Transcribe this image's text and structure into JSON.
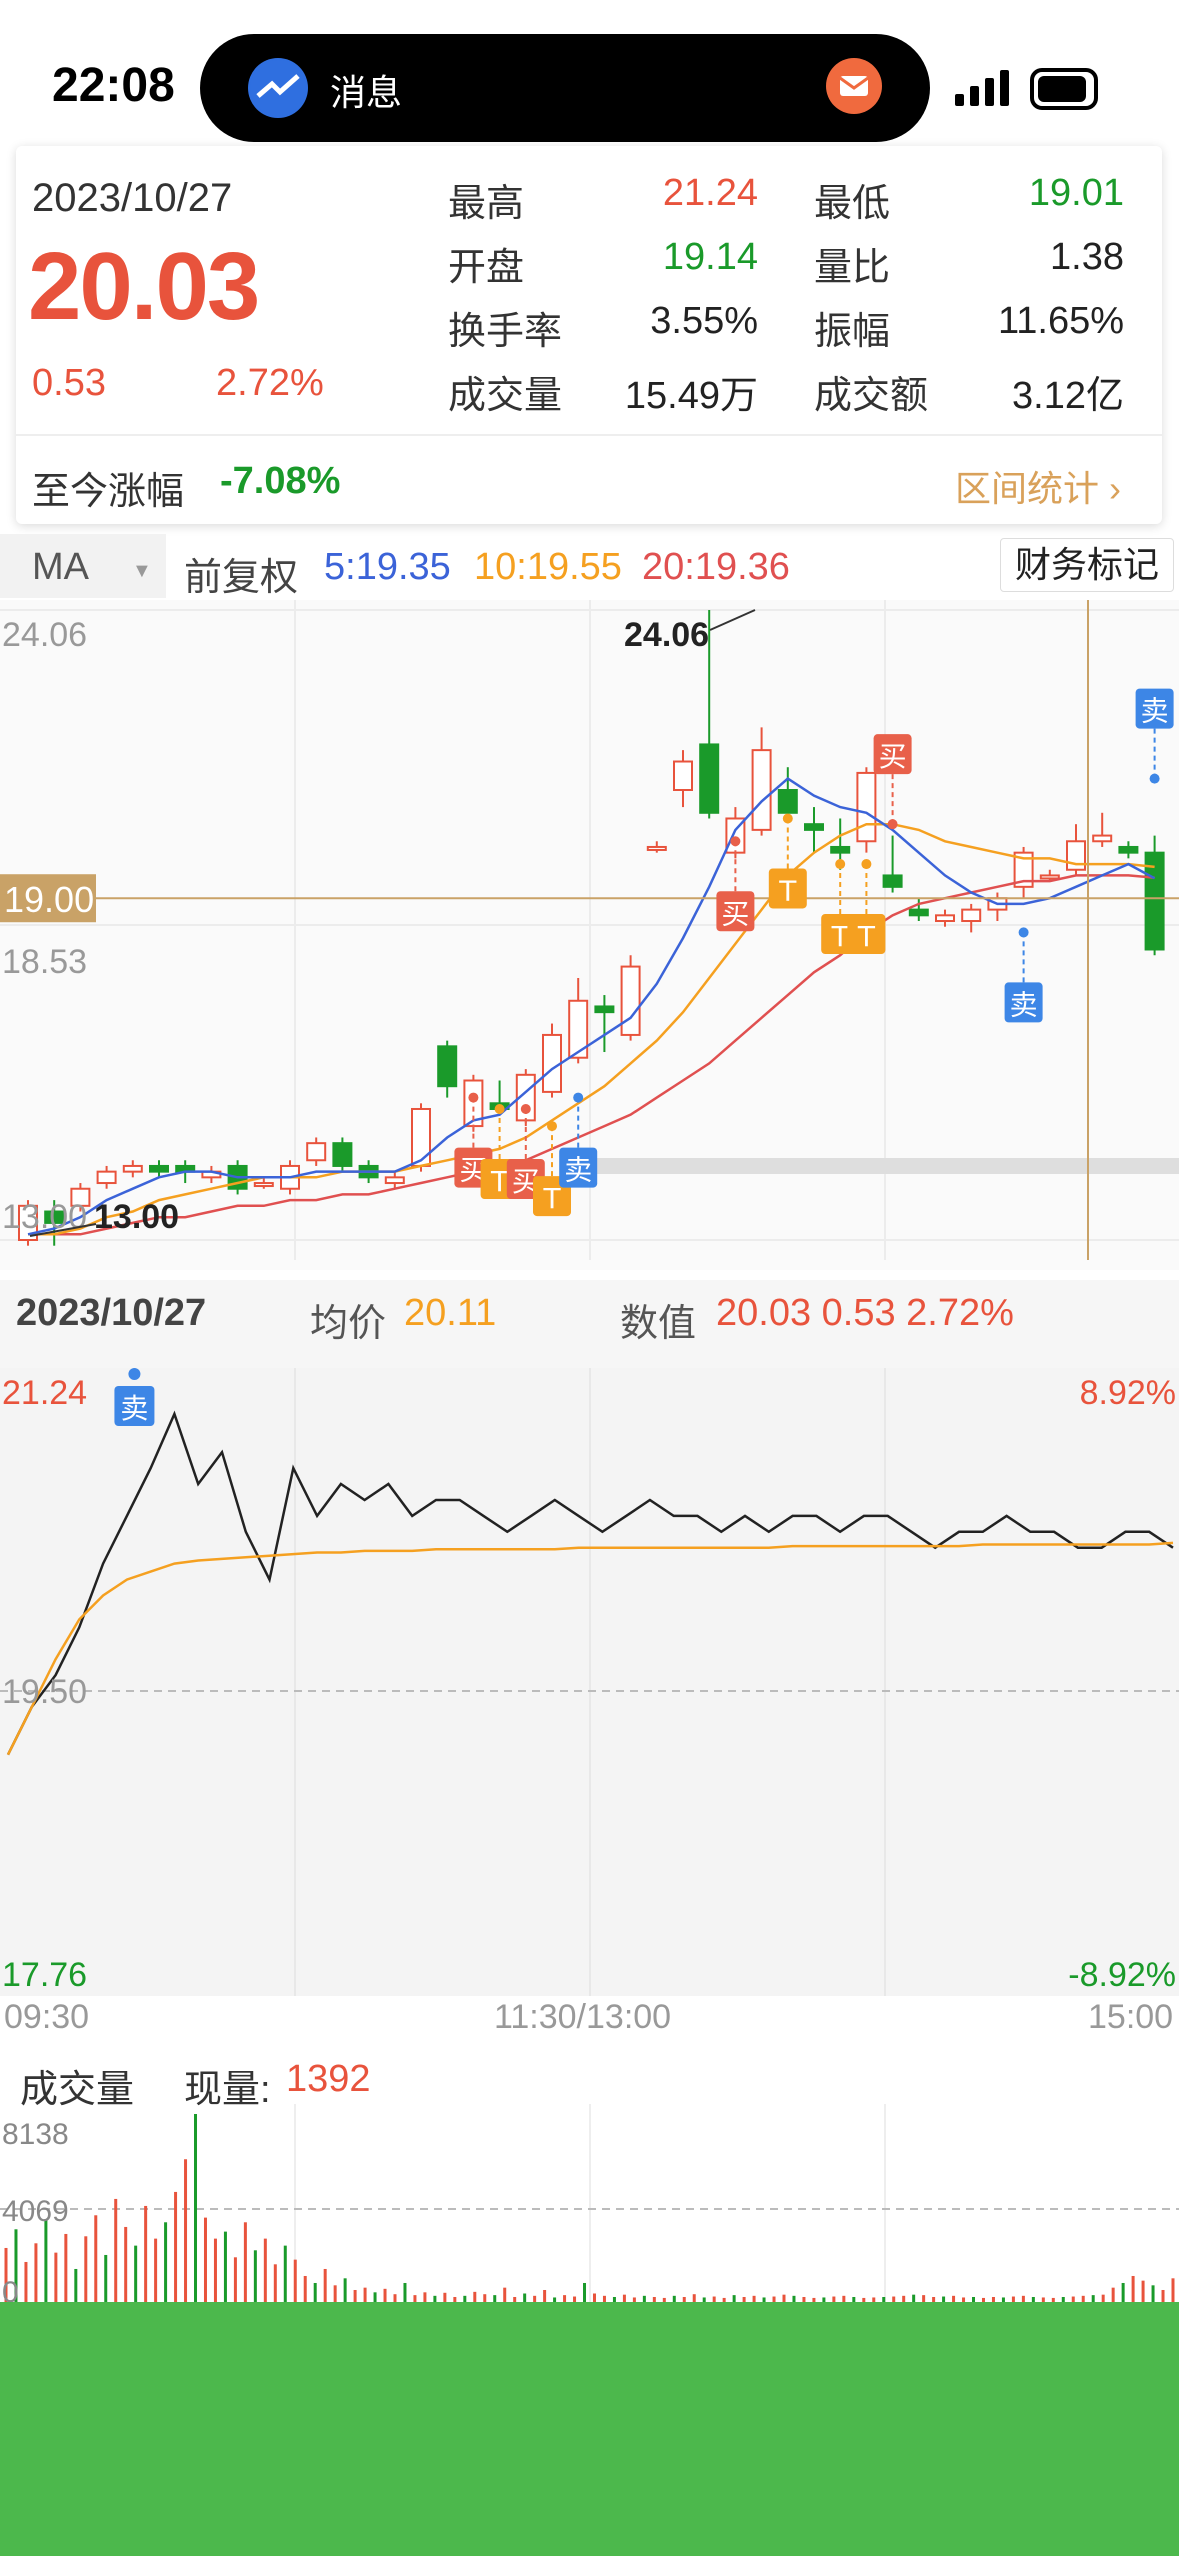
{
  "status_bar": {
    "time": "22:08",
    "island_label": "消息"
  },
  "quote": {
    "date": "2023/10/27",
    "price": "20.03",
    "change": "0.53",
    "change_pct": "2.72%",
    "high_label": "最高",
    "high": "21.24",
    "low_label": "最低",
    "low": "19.01",
    "open_label": "开盘",
    "open": "19.14",
    "volume_ratio_label": "量比",
    "volume_ratio": "1.38",
    "turnover_label": "换手率",
    "turnover": "3.55%",
    "amplitude_label": "振幅",
    "amplitude": "11.65%",
    "volume_label": "成交量",
    "volume": "15.49万",
    "amount_label": "成交额",
    "amount": "3.12亿",
    "since_label": "至今涨幅",
    "since": "-7.08%",
    "interval_link": "区间统计 ›"
  },
  "ma_bar": {
    "select": "MA",
    "adjust": "前复权",
    "ma5": "5:19.35",
    "ma10": "10:19.55",
    "ma20": "20:19.36",
    "finance_mark": "财务标记"
  },
  "intraday_header": {
    "date": "2023/10/27",
    "avg_label": "均价",
    "avg": "20.11",
    "value_label": "数值",
    "value": "20.03 0.53 2.72%"
  },
  "volume_header": {
    "label": "成交量",
    "now_label": "现量:",
    "now": "1392"
  },
  "colors": {
    "up": "#e8533c",
    "down": "#1a9a2a",
    "ma5": "#3b63d8",
    "ma10": "#f5a020",
    "ma20": "#e05050",
    "cross": "#c9a267"
  },
  "chart_data": [
    {
      "type": "candlestick",
      "ylim": [
        13.0,
        24.06
      ],
      "y_labels": [
        "24.06",
        "18.53",
        "13.00"
      ],
      "max_label": "24.06",
      "min_label": "13.00",
      "crosshair_price": "19.00",
      "markers": [
        "买",
        "卖",
        "T"
      ],
      "candles": [
        {
          "o": 13.0,
          "c": 13.6,
          "h": 13.7,
          "l": 12.9
        },
        {
          "o": 13.5,
          "c": 13.3,
          "h": 13.7,
          "l": 12.9
        },
        {
          "o": 13.6,
          "c": 13.9,
          "h": 14.0,
          "l": 13.5
        },
        {
          "o": 14.0,
          "c": 14.2,
          "h": 14.3,
          "l": 13.9
        },
        {
          "o": 14.2,
          "c": 14.3,
          "h": 14.4,
          "l": 14.1
        },
        {
          "o": 14.3,
          "c": 14.2,
          "h": 14.4,
          "l": 14.1
        },
        {
          "o": 14.3,
          "c": 14.2,
          "h": 14.4,
          "l": 14.0
        },
        {
          "o": 14.1,
          "c": 14.2,
          "h": 14.3,
          "l": 14.0
        },
        {
          "o": 14.3,
          "c": 13.9,
          "h": 14.4,
          "l": 13.8
        },
        {
          "o": 14.0,
          "c": 14.0,
          "h": 14.1,
          "l": 13.9
        },
        {
          "o": 13.9,
          "c": 14.3,
          "h": 14.4,
          "l": 13.8
        },
        {
          "o": 14.4,
          "c": 14.7,
          "h": 14.8,
          "l": 14.3
        },
        {
          "o": 14.7,
          "c": 14.3,
          "h": 14.8,
          "l": 14.2
        },
        {
          "o": 14.3,
          "c": 14.1,
          "h": 14.4,
          "l": 14.0
        },
        {
          "o": 14.0,
          "c": 14.1,
          "h": 14.2,
          "l": 13.9
        },
        {
          "o": 14.3,
          "c": 15.3,
          "h": 15.4,
          "l": 14.2
        },
        {
          "o": 16.4,
          "c": 15.7,
          "h": 16.5,
          "l": 15.5
        },
        {
          "o": 15.0,
          "c": 15.8,
          "h": 15.9,
          "l": 14.9
        },
        {
          "o": 15.4,
          "c": 15.3,
          "h": 15.8,
          "l": 15.2
        },
        {
          "o": 15.1,
          "c": 15.9,
          "h": 16.0,
          "l": 15.0
        },
        {
          "o": 15.6,
          "c": 16.6,
          "h": 16.8,
          "l": 15.5
        },
        {
          "o": 16.2,
          "c": 17.2,
          "h": 17.6,
          "l": 16.1
        },
        {
          "o": 17.1,
          "c": 17.0,
          "h": 17.3,
          "l": 16.3
        },
        {
          "o": 16.6,
          "c": 17.8,
          "h": 18.0,
          "l": 16.5
        },
        {
          "o": 19.9,
          "c": 19.9,
          "h": 20.0,
          "l": 19.8
        },
        {
          "o": 20.9,
          "c": 21.4,
          "h": 21.6,
          "l": 20.6
        },
        {
          "o": 21.7,
          "c": 20.5,
          "h": 24.06,
          "l": 20.4
        },
        {
          "o": 19.8,
          "c": 20.4,
          "h": 20.6,
          "l": 19.7
        },
        {
          "o": 20.2,
          "c": 21.6,
          "h": 22.0,
          "l": 20.1
        },
        {
          "o": 20.9,
          "c": 20.5,
          "h": 21.3,
          "l": 20.4
        },
        {
          "o": 20.3,
          "c": 20.2,
          "h": 20.6,
          "l": 19.8
        },
        {
          "o": 19.9,
          "c": 19.8,
          "h": 20.4,
          "l": 19.5
        },
        {
          "o": 20.0,
          "c": 21.2,
          "h": 21.3,
          "l": 19.8
        },
        {
          "o": 19.4,
          "c": 19.2,
          "h": 20.1,
          "l": 19.1
        },
        {
          "o": 18.8,
          "c": 18.7,
          "h": 19.0,
          "l": 18.6
        },
        {
          "o": 18.6,
          "c": 18.7,
          "h": 18.8,
          "l": 18.5
        },
        {
          "o": 18.6,
          "c": 18.8,
          "h": 18.9,
          "l": 18.4
        },
        {
          "o": 18.8,
          "c": 19.0,
          "h": 19.1,
          "l": 18.6
        },
        {
          "o": 19.2,
          "c": 19.8,
          "h": 19.9,
          "l": 19.0
        },
        {
          "o": 19.4,
          "c": 19.4,
          "h": 19.5,
          "l": 19.3
        },
        {
          "o": 19.5,
          "c": 20.0,
          "h": 20.3,
          "l": 19.4
        },
        {
          "o": 20.0,
          "c": 20.1,
          "h": 20.5,
          "l": 19.9
        },
        {
          "o": 19.9,
          "c": 19.8,
          "h": 20.0,
          "l": 19.7
        },
        {
          "o": 19.8,
          "c": 18.1,
          "h": 20.1,
          "l": 18.0
        }
      ],
      "ma5": [
        13.1,
        13.2,
        13.4,
        13.7,
        13.9,
        14.1,
        14.2,
        14.2,
        14.1,
        14.1,
        14.1,
        14.2,
        14.2,
        14.2,
        14.2,
        14.4,
        14.8,
        15.1,
        15.2,
        15.6,
        16.0,
        16.3,
        16.6,
        16.9,
        17.5,
        18.3,
        19.2,
        20.2,
        20.7,
        21.1,
        20.8,
        20.6,
        20.5,
        20.2,
        19.8,
        19.4,
        19.1,
        18.9,
        18.9,
        19.0,
        19.2,
        19.4,
        19.6,
        19.35
      ],
      "ma10": [
        13.1,
        13.1,
        13.2,
        13.4,
        13.5,
        13.7,
        13.8,
        13.9,
        14.0,
        14.1,
        14.1,
        14.1,
        14.2,
        14.2,
        14.2,
        14.3,
        14.4,
        14.5,
        14.6,
        14.8,
        15.1,
        15.4,
        15.7,
        16.1,
        16.5,
        17.0,
        17.6,
        18.2,
        18.8,
        19.4,
        19.8,
        20.1,
        20.3,
        20.3,
        20.2,
        20.0,
        19.9,
        19.8,
        19.7,
        19.7,
        19.6,
        19.6,
        19.6,
        19.55
      ],
      "ma20": [
        13.1,
        13.1,
        13.1,
        13.2,
        13.3,
        13.4,
        13.4,
        13.5,
        13.6,
        13.6,
        13.7,
        13.7,
        13.8,
        13.8,
        13.9,
        14.0,
        14.1,
        14.2,
        14.3,
        14.4,
        14.6,
        14.8,
        15.0,
        15.2,
        15.5,
        15.8,
        16.1,
        16.5,
        16.9,
        17.3,
        17.7,
        18.0,
        18.4,
        18.7,
        18.9,
        19.0,
        19.1,
        19.2,
        19.3,
        19.3,
        19.4,
        19.4,
        19.4,
        19.36
      ]
    },
    {
      "type": "line",
      "ylim": [
        17.76,
        21.24
      ],
      "y_labels": [
        "21.24",
        "19.50",
        "17.76"
      ],
      "pct_labels": [
        "8.92%",
        "-8.92%"
      ],
      "x_labels": [
        "09:30",
        "11:30/13:00",
        "15:00"
      ],
      "marker": "卖",
      "series": [
        {
          "values": [
            19.1,
            19.4,
            19.6,
            19.9,
            20.3,
            20.6,
            20.9,
            21.24,
            20.8,
            21.0,
            20.5,
            20.2,
            20.9,
            20.6,
            20.8,
            20.7,
            20.8,
            20.6,
            20.7,
            20.7,
            20.6,
            20.5,
            20.6,
            20.7,
            20.6,
            20.5,
            20.6,
            20.7,
            20.6,
            20.6,
            20.5,
            20.6,
            20.5,
            20.6,
            20.6,
            20.5,
            20.6,
            20.6,
            20.5,
            20.4,
            20.5,
            20.5,
            20.6,
            20.5,
            20.5,
            20.4,
            20.4,
            20.5,
            20.5,
            20.4
          ]
        },
        {
          "values": [
            19.1,
            19.4,
            19.7,
            19.95,
            20.1,
            20.2,
            20.25,
            20.3,
            20.32,
            20.33,
            20.34,
            20.35,
            20.36,
            20.37,
            20.37,
            20.38,
            20.38,
            20.38,
            20.39,
            20.39,
            20.39,
            20.39,
            20.39,
            20.39,
            20.4,
            20.4,
            20.4,
            20.4,
            20.4,
            20.4,
            20.4,
            20.4,
            20.4,
            20.41,
            20.41,
            20.41,
            20.41,
            20.41,
            20.41,
            20.41,
            20.41,
            20.42,
            20.42,
            20.42,
            20.42,
            20.42,
            20.42,
            20.42,
            20.42,
            20.43
          ]
        }
      ]
    },
    {
      "type": "bar",
      "ylim": [
        0,
        8138
      ],
      "y_labels": [
        "8138",
        "4069",
        "0"
      ],
      "values": [
        2400,
        3200,
        1800,
        2600,
        3600,
        2200,
        3000,
        1500,
        2900,
        3800,
        2100,
        4500,
        3300,
        2500,
        4200,
        2800,
        3500,
        4800,
        6200,
        8138,
        3700,
        2800,
        3100,
        2000,
        3500,
        2300,
        2800,
        1700,
        2500,
        1900,
        1200,
        900,
        1500,
        800,
        1100,
        600,
        700,
        500,
        650,
        420,
        900,
        380,
        500,
        350,
        480,
        300,
        350,
        520,
        420,
        380,
        700,
        300,
        450,
        350,
        600,
        280,
        380,
        320,
        900,
        450,
        350,
        300,
        400,
        280,
        350,
        300,
        260,
        350,
        300,
        420,
        280,
        320,
        260,
        380,
        300,
        350,
        280,
        320,
        400,
        350,
        300,
        260,
        280,
        320,
        350,
        300,
        260,
        280,
        300,
        320,
        350,
        400,
        380,
        300,
        320,
        350,
        280,
        300,
        260,
        300,
        280,
        320,
        350,
        300,
        280,
        260,
        300,
        320,
        350,
        380,
        400,
        700,
        900,
        1200,
        1000,
        800,
        600,
        1100
      ]
    }
  ]
}
